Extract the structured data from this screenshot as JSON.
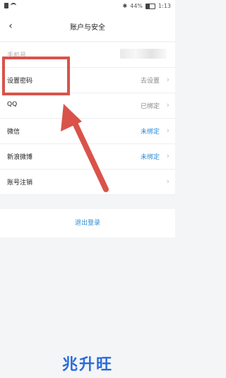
{
  "status_bar": {
    "battery_percent": "44%",
    "time": "1:13"
  },
  "nav": {
    "title": "账户与安全"
  },
  "rows": [
    {
      "label": "手机号",
      "value": "",
      "blurred": true
    },
    {
      "label": "设置密码",
      "value": "去设置"
    },
    {
      "label": "QQ",
      "value": "已绑定"
    },
    {
      "label": "微信",
      "value": "未绑定"
    },
    {
      "label": "新浪微博",
      "value": "未绑定"
    },
    {
      "label": "账号注销",
      "value": ""
    }
  ],
  "logout": {
    "label": "退出登录"
  },
  "watermark": {
    "text": "兆升旺"
  },
  "colors": {
    "accent_blue": "#2a8bd8",
    "annotation_red": "#d9534a"
  }
}
